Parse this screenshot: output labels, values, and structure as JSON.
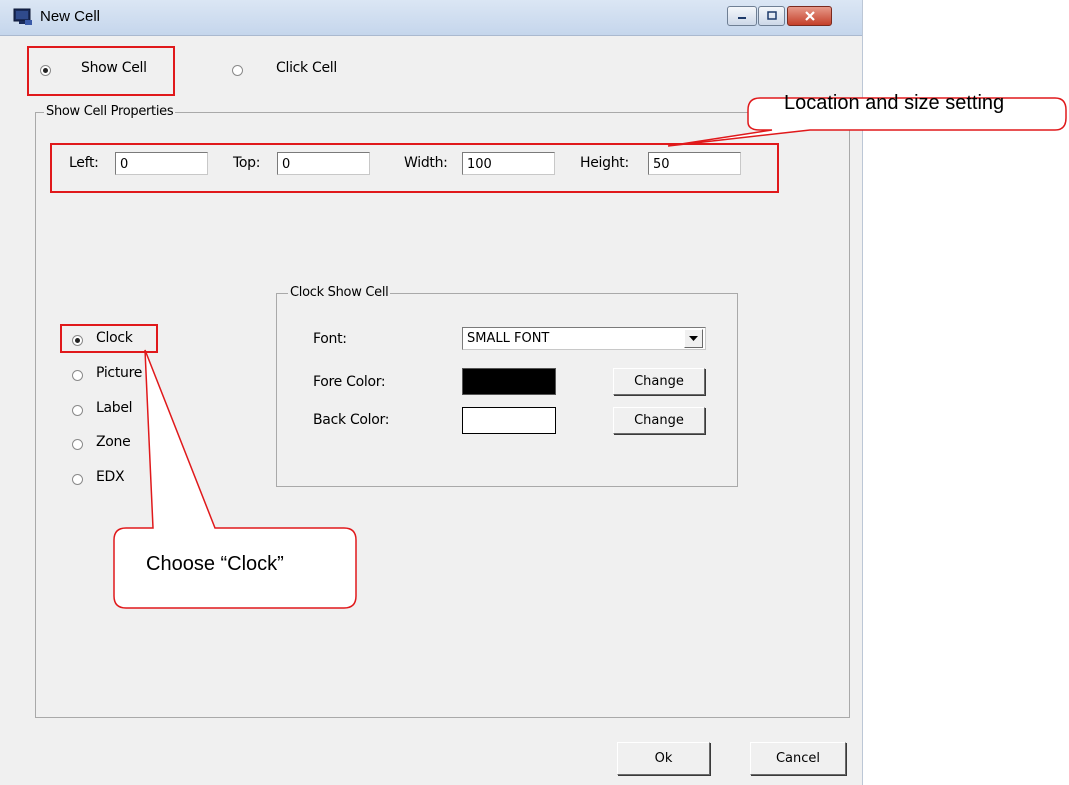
{
  "window": {
    "title": "New Cell"
  },
  "mode": {
    "show_cell_label": "Show Cell",
    "click_cell_label": "Click Cell",
    "selected": "Show Cell"
  },
  "show_cell_properties": {
    "title": "Show Cell Properties",
    "left_label": "Left:",
    "left_value": "0",
    "top_label": "Top:",
    "top_value": "0",
    "width_label": "Width:",
    "width_value": "100",
    "height_label": "Height:",
    "height_value": "50"
  },
  "cell_types": {
    "items": [
      "Clock",
      "Picture",
      "Label",
      "Zone",
      "EDX"
    ],
    "selected": "Clock"
  },
  "clock_show_cell": {
    "title": "Clock Show Cell",
    "font_label": "Font:",
    "font_value": "SMALL FONT",
    "fore_color_label": "Fore Color:",
    "fore_color": "#000000",
    "back_color_label": "Back Color:",
    "back_color": "#ffffff",
    "change_label": "Change"
  },
  "buttons": {
    "ok": "Ok",
    "cancel": "Cancel"
  },
  "annotations": {
    "location_callout": "Location and size setting",
    "clock_callout": "Choose “Clock”",
    "highlight_color": "#e0191b"
  }
}
